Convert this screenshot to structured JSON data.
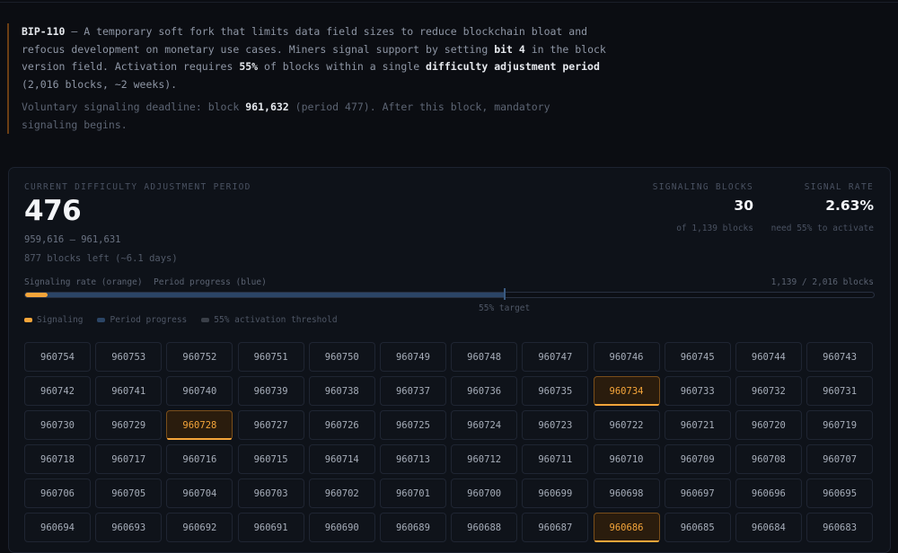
{
  "intro": {
    "name": "BIP-110",
    "p1": " — A temporary soft fork that limits data field sizes to reduce blockchain bloat and refocus development on monetary use cases. Miners signal support by setting ",
    "bit": "bit 4",
    "p2": " in the block version field. Activation requires ",
    "pct": "55%",
    "p3": " of blocks within a single ",
    "dap": "difficulty adjustment period",
    "p4": " (2,016 blocks, ~2 weeks).",
    "d1": "Voluntary signaling deadline: block ",
    "deadline_block": "961,632",
    "d2": " (period 477). After this block, mandatory signaling begins."
  },
  "period": {
    "label": "CURRENT DIFFICULTY ADJUSTMENT PERIOD",
    "number": "476",
    "range": "959,616 – 961,631",
    "left": "877 blocks left (~6.1 days)"
  },
  "stats": {
    "signaling_label": "SIGNALING BLOCKS",
    "signaling_value": "30",
    "signaling_sub": "of 1,139 blocks",
    "rate_label": "SIGNAL RATE",
    "rate_value": "2.63%",
    "rate_sub": "need 55% to activate"
  },
  "progress": {
    "left_label": "Signaling rate (orange)",
    "mid_label": "Period progress (blue)",
    "right_label": "1,139 / 2,016 blocks",
    "period_fraction": 0.565,
    "signal_fraction": 0.0263,
    "target_fraction": 0.55,
    "target_label": "55% target",
    "colors": {
      "signal": "#f5a53a",
      "period": "#2b4566",
      "threshold": "#3a3f48"
    }
  },
  "legend": [
    "Signaling",
    "Period progress",
    "55% activation threshold"
  ],
  "blocks": [
    {
      "h": "960754",
      "s": false
    },
    {
      "h": "960753",
      "s": false
    },
    {
      "h": "960752",
      "s": false
    },
    {
      "h": "960751",
      "s": false
    },
    {
      "h": "960750",
      "s": false
    },
    {
      "h": "960749",
      "s": false
    },
    {
      "h": "960748",
      "s": false
    },
    {
      "h": "960747",
      "s": false
    },
    {
      "h": "960746",
      "s": false
    },
    {
      "h": "960745",
      "s": false
    },
    {
      "h": "960744",
      "s": false
    },
    {
      "h": "960743",
      "s": false
    },
    {
      "h": "960742",
      "s": false
    },
    {
      "h": "960741",
      "s": false
    },
    {
      "h": "960740",
      "s": false
    },
    {
      "h": "960739",
      "s": false
    },
    {
      "h": "960738",
      "s": false
    },
    {
      "h": "960737",
      "s": false
    },
    {
      "h": "960736",
      "s": false
    },
    {
      "h": "960735",
      "s": false
    },
    {
      "h": "960734",
      "s": true
    },
    {
      "h": "960733",
      "s": false
    },
    {
      "h": "960732",
      "s": false
    },
    {
      "h": "960731",
      "s": false
    },
    {
      "h": "960730",
      "s": false
    },
    {
      "h": "960729",
      "s": false
    },
    {
      "h": "960728",
      "s": true
    },
    {
      "h": "960727",
      "s": false
    },
    {
      "h": "960726",
      "s": false
    },
    {
      "h": "960725",
      "s": false
    },
    {
      "h": "960724",
      "s": false
    },
    {
      "h": "960723",
      "s": false
    },
    {
      "h": "960722",
      "s": false
    },
    {
      "h": "960721",
      "s": false
    },
    {
      "h": "960720",
      "s": false
    },
    {
      "h": "960719",
      "s": false
    },
    {
      "h": "960718",
      "s": false
    },
    {
      "h": "960717",
      "s": false
    },
    {
      "h": "960716",
      "s": false
    },
    {
      "h": "960715",
      "s": false
    },
    {
      "h": "960714",
      "s": false
    },
    {
      "h": "960713",
      "s": false
    },
    {
      "h": "960712",
      "s": false
    },
    {
      "h": "960711",
      "s": false
    },
    {
      "h": "960710",
      "s": false
    },
    {
      "h": "960709",
      "s": false
    },
    {
      "h": "960708",
      "s": false
    },
    {
      "h": "960707",
      "s": false
    },
    {
      "h": "960706",
      "s": false
    },
    {
      "h": "960705",
      "s": false
    },
    {
      "h": "960704",
      "s": false
    },
    {
      "h": "960703",
      "s": false
    },
    {
      "h": "960702",
      "s": false
    },
    {
      "h": "960701",
      "s": false
    },
    {
      "h": "960700",
      "s": false
    },
    {
      "h": "960699",
      "s": false
    },
    {
      "h": "960698",
      "s": false
    },
    {
      "h": "960697",
      "s": false
    },
    {
      "h": "960696",
      "s": false
    },
    {
      "h": "960695",
      "s": false
    },
    {
      "h": "960694",
      "s": false
    },
    {
      "h": "960693",
      "s": false
    },
    {
      "h": "960692",
      "s": false
    },
    {
      "h": "960691",
      "s": false
    },
    {
      "h": "960690",
      "s": false
    },
    {
      "h": "960689",
      "s": false
    },
    {
      "h": "960688",
      "s": false
    },
    {
      "h": "960687",
      "s": false
    },
    {
      "h": "960686",
      "s": true
    },
    {
      "h": "960685",
      "s": false
    },
    {
      "h": "960684",
      "s": false
    },
    {
      "h": "960683",
      "s": false
    }
  ]
}
